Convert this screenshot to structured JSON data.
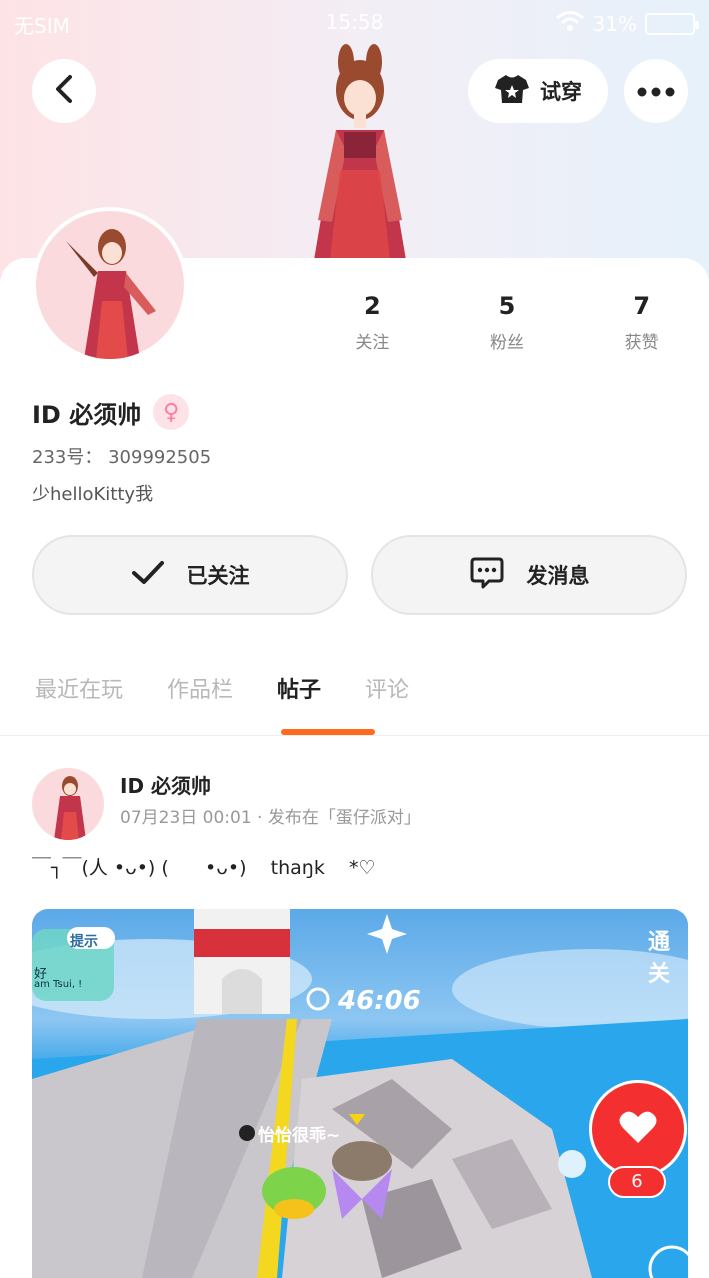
{
  "status_bar": {
    "sim": "无SIM",
    "time": "15:58",
    "battery": "31%"
  },
  "header": {
    "try_on_label": "试穿"
  },
  "profile": {
    "name": "ID 必须帅",
    "uid_label": "233号：",
    "uid": "309992505",
    "bio": "少helloKitty我"
  },
  "stats": [
    {
      "value": "2",
      "label": "关注"
    },
    {
      "value": "5",
      "label": "粉丝"
    },
    {
      "value": "7",
      "label": "获赞"
    }
  ],
  "actions": {
    "follow_label": "已关注",
    "message_label": "发消息"
  },
  "tabs": [
    {
      "label": "最近在玩",
      "active": false
    },
    {
      "label": "作品栏",
      "active": false
    },
    {
      "label": "帖子",
      "active": true
    },
    {
      "label": "评论",
      "active": false
    }
  ],
  "post": {
    "author": "ID 必须帅",
    "meta": "07月23日 00:01 · 发布在「蛋仔派对」",
    "text": "￣┐￣(人 •ᴗ•) (      •ᴗ•)    thaŋk    *♡",
    "image": {
      "hint_label": "提示",
      "hint_text": "好",
      "hint_sub": "am Tsui, !",
      "timer": "46:06",
      "clear_label": "通关",
      "player_name": "怡怡很乖~"
    }
  },
  "like": {
    "count": "6"
  },
  "colors": {
    "accent": "#ff6a1f",
    "like": "#f3302f",
    "gender": "#ff7ba1"
  }
}
